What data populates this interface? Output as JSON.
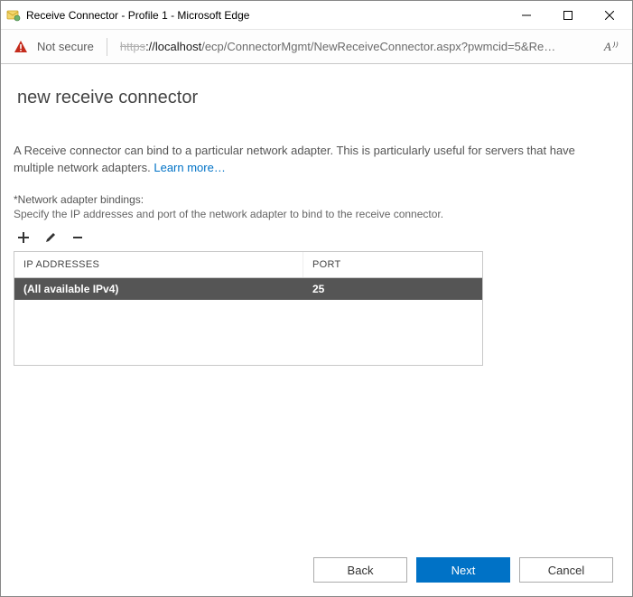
{
  "window": {
    "title": "Receive Connector - Profile 1 - Microsoft Edge"
  },
  "addressbar": {
    "security_label": "Not secure",
    "url_protocol": "https",
    "url_host": "://localhost",
    "url_path": "/ecp/ConnectorMgmt/NewReceiveConnector.aspx?pwmcid=5&Re…",
    "read_aloud_glyph": "A⁾⁾"
  },
  "page": {
    "title": "new receive connector",
    "description_prefix": "A Receive connector can bind to a particular network adapter. This is particularly useful for servers that have multiple network adapters. ",
    "learn_more": "Learn more…",
    "bindings_label": "*Network adapter bindings:",
    "bindings_sub": "Specify the IP addresses and port of the network adapter to bind to the receive connector."
  },
  "grid": {
    "headers": {
      "ip": "IP ADDRESSES",
      "port": "PORT"
    },
    "rows": [
      {
        "ip": "(All available IPv4)",
        "port": "25",
        "selected": true
      }
    ]
  },
  "buttons": {
    "back": "Back",
    "next": "Next",
    "cancel": "Cancel"
  }
}
